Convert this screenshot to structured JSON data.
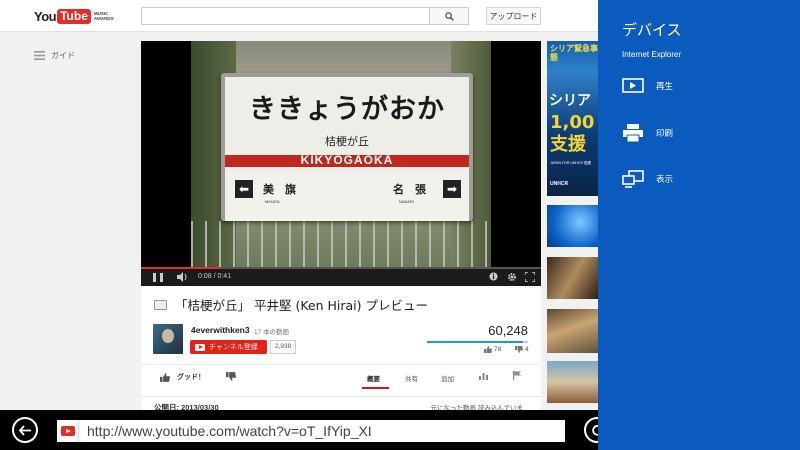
{
  "header": {
    "logo": {
      "you": "You",
      "tube": "Tube",
      "awards": "MUSIC AWARDS"
    },
    "search": {
      "placeholder": "",
      "value": ""
    },
    "upload_label": "アップロード"
  },
  "guide": {
    "label": "ガイド"
  },
  "player": {
    "sign": {
      "hiragana": "ききょうがおか",
      "kanji": "桔梗が丘",
      "romaji": "KIKYŌGAOKA",
      "prev_station": "美　旗",
      "prev_romaji": "MIHATA",
      "next_station": "名　張",
      "next_romaji": "NABARI",
      "prev_arrow": "⬅",
      "next_arrow": "➡"
    },
    "time": "0:08 / 0:41",
    "progress": 0.195
  },
  "video": {
    "title": "「桔梗が丘」 平井堅 (Ken Hirai) プレビュー",
    "channel": "4everwithken3",
    "video_count": "17 本の動画",
    "subscribe_label": "チャンネル登録",
    "subscriber_count": "2,938",
    "views": "60,248",
    "likes": "78",
    "dislikes": "4",
    "like_ratio": 0.95,
    "good_label": "グッド！",
    "tabs": [
      "概要",
      "共有",
      "追加"
    ],
    "published": "公開日: 2013/03/30",
    "related_note": "元になった動画 読み込んでいま"
  },
  "sidebar": {
    "ad": {
      "top": "シリア緊急事態",
      "line1": "シリア",
      "line2": "1,00",
      "line3": "支援",
      "foot": "JAPAN FOR UNHCR 国連",
      "org": "UNHCR"
    }
  },
  "ie": {
    "address": "http://www.youtube.com/watch?v=oT_IfYip_XI"
  },
  "charm": {
    "title": "デバイス",
    "subtitle": "Internet Explorer",
    "items": [
      {
        "label": "再生",
        "icon": "play-to-icon"
      },
      {
        "label": "印刷",
        "icon": "printer-icon"
      },
      {
        "label": "表示",
        "icon": "project-icon"
      }
    ]
  },
  "colors": {
    "youtube_red": "#e52d27",
    "charm_blue": "#0b5bbf",
    "like_blue": "#2793e6"
  }
}
